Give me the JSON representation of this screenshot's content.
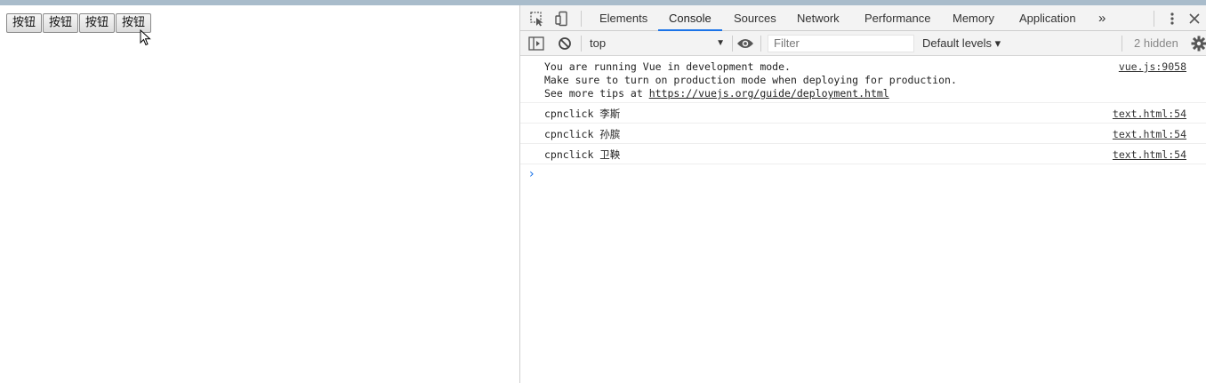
{
  "page": {
    "buttons": [
      "按钮",
      "按钮",
      "按钮",
      "按钮"
    ]
  },
  "devtools": {
    "tabs": [
      "Elements",
      "Console",
      "Sources",
      "Network",
      "Performance",
      "Memory",
      "Application"
    ],
    "more_tabs": "»",
    "context": "top",
    "filter_placeholder": "Filter",
    "levels": "Default levels ▾",
    "hidden": "2 hidden"
  },
  "console": {
    "vue_lines": [
      "You are running Vue in development mode.",
      "Make sure to turn on production mode when deploying for production.",
      "See more tips at "
    ],
    "vue_link": "https://vuejs.org/guide/deployment.html",
    "vue_source": "vue.js:9058",
    "logs": [
      {
        "text": "cpnclick 李斯",
        "source": "text.html:54"
      },
      {
        "text": "cpnclick 孙膑",
        "source": "text.html:54"
      },
      {
        "text": "cpnclick 卫鞅",
        "source": "text.html:54"
      }
    ],
    "prompt": "›"
  },
  "colors": {
    "accent": "#1a73e8",
    "toolbar_bg": "#f3f3f3",
    "top_strip": "#a9bccb"
  }
}
